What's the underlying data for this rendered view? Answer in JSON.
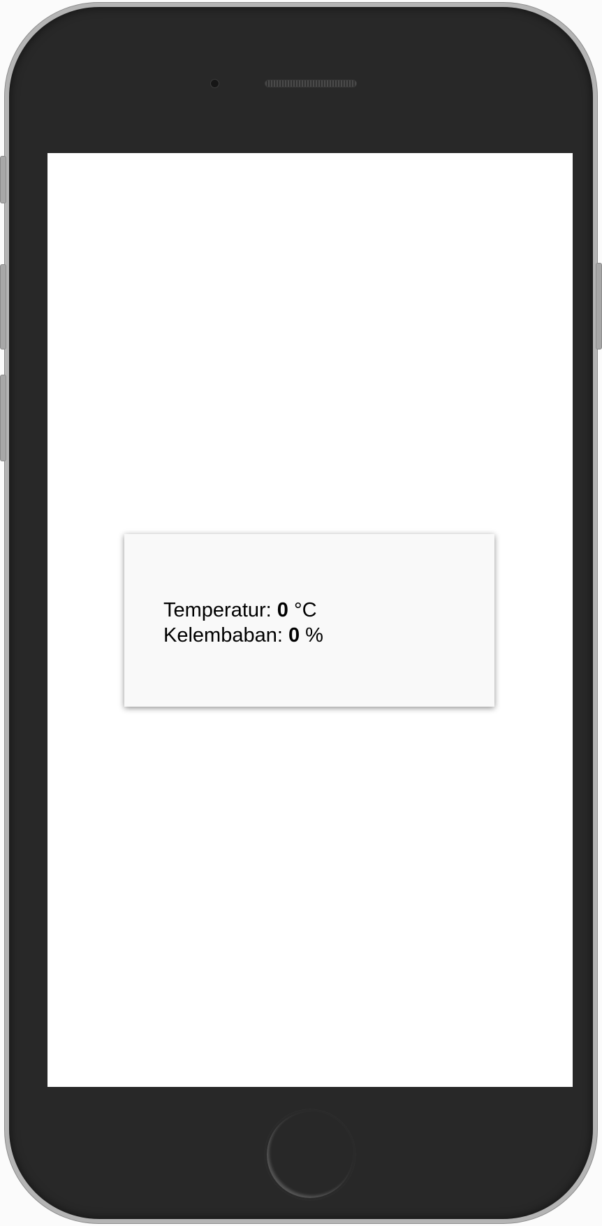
{
  "sensor": {
    "temperature_label": "Temperatur:",
    "temperature_value": "0",
    "temperature_unit": "°C",
    "humidity_label": "Kelembaban:",
    "humidity_value": "0",
    "humidity_unit": "%"
  },
  "colors": {
    "phone_frame": "#b4b4b4",
    "phone_body": "#282828",
    "screen": "#ffffff",
    "card": "#f9f9f9"
  },
  "icons": [
    "camera-icon",
    "speaker-icon",
    "home-button-icon"
  ]
}
